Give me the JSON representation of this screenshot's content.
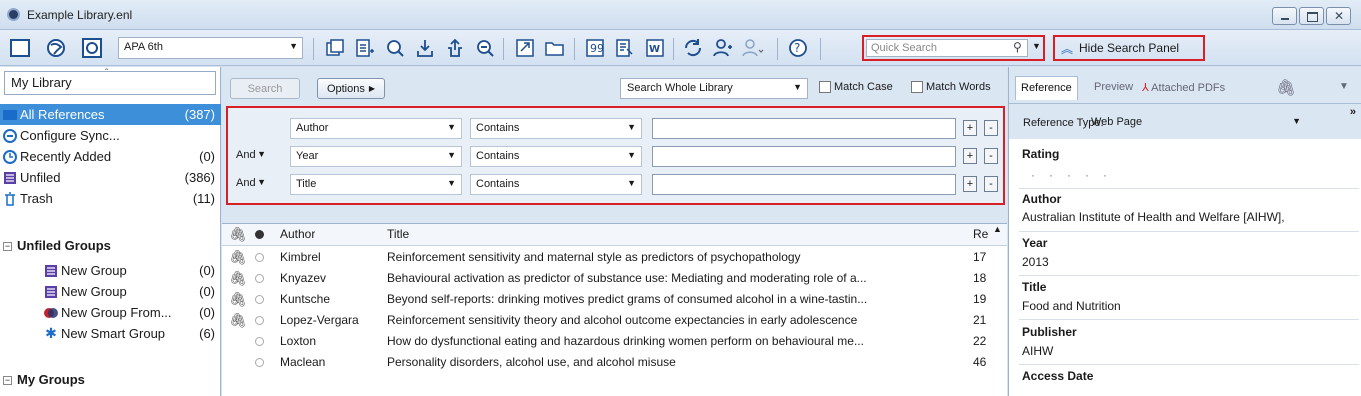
{
  "window": {
    "title": "Example Library.enl"
  },
  "toolbar": {
    "style": "APA 6th",
    "quick_search_placeholder": "Quick Search",
    "hide_search_panel": "Hide Search Panel"
  },
  "sidebar": {
    "header": "My Library",
    "items": [
      {
        "label": "All References",
        "count": "(387)"
      },
      {
        "label": "Configure Sync...",
        "count": ""
      },
      {
        "label": "Recently Added",
        "count": "(0)"
      },
      {
        "label": "Unfiled",
        "count": "(386)"
      },
      {
        "label": "Trash",
        "count": "(11)"
      }
    ],
    "unfiled_groups_header": "Unfiled Groups",
    "groups": [
      {
        "label": "New Group",
        "count": "(0)"
      },
      {
        "label": "New Group",
        "count": "(0)"
      },
      {
        "label": "New Group From...",
        "count": "(0)"
      },
      {
        "label": "New Smart Group",
        "count": "(6)"
      }
    ],
    "my_groups_header": "My Groups"
  },
  "search_panel": {
    "search_button": "Search",
    "options_button": "Options",
    "scope": "Search Whole Library",
    "match_case": "Match Case",
    "match_words": "Match Words",
    "rows": [
      {
        "connector": "",
        "field": "Author",
        "operator": "Contains",
        "value": ""
      },
      {
        "connector": "And",
        "field": "Year",
        "operator": "Contains",
        "value": ""
      },
      {
        "connector": "And",
        "field": "Title",
        "operator": "Contains",
        "value": ""
      }
    ]
  },
  "references": {
    "headers": {
      "author": "Author",
      "title": "Title",
      "year": "Re"
    },
    "rows": [
      {
        "author": "Kimbrel",
        "title": "Reinforcement sensitivity and maternal style as predictors of psychopathology",
        "rec": "17"
      },
      {
        "author": "Knyazev",
        "title": "Behavioural activation as predictor of substance use: Mediating and moderating role of a...",
        "rec": "18"
      },
      {
        "author": "Kuntsche",
        "title": "Beyond self-reports: drinking motives predict grams of consumed alcohol in a wine-tastin...",
        "rec": "19"
      },
      {
        "author": "Lopez-Vergara",
        "title": "Reinforcement sensitivity theory and alcohol outcome expectancies in early adolescence",
        "rec": "21"
      },
      {
        "author": "Loxton",
        "title": "How do dysfunctional eating and hazardous drinking women perform on behavioural me...",
        "rec": "22"
      },
      {
        "author": "Maclean",
        "title": "Personality disorders, alcohol use, and alcohol misuse",
        "rec": "46"
      }
    ]
  },
  "reference_panel": {
    "tabs": {
      "reference": "Reference",
      "preview": "Preview",
      "attached": "Attached PDFs"
    },
    "ref_type_label": "Reference Type:",
    "ref_type_value": "Web Page",
    "fields": [
      {
        "label": "Rating",
        "value": ""
      },
      {
        "label": "Author",
        "value": "Australian Institute of Health and Welfare [AIHW],"
      },
      {
        "label": "Year",
        "value": "2013"
      },
      {
        "label": "Title",
        "value": "Food and Nutrition"
      },
      {
        "label": "Publisher",
        "value": "AIHW"
      },
      {
        "label": "Access Date",
        "value": ""
      }
    ]
  }
}
